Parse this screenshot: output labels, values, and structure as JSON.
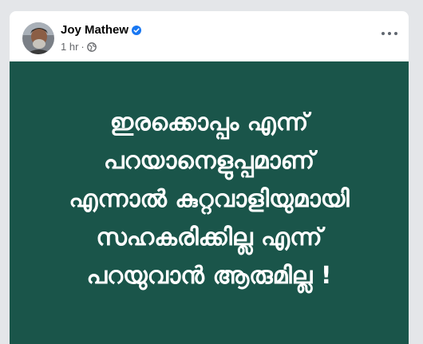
{
  "post": {
    "author": {
      "name": "Joy Mathew",
      "verified_icon": "verified-badge-icon"
    },
    "timestamp": "1 hr",
    "separator": "·",
    "audience_icon": "globe-icon",
    "more_icon": "more-options-icon",
    "image": {
      "background_color": "#1a554a",
      "text_color": "#ffffff",
      "lines": [
        "ഇരക്കൊപ്പം എന്ന്",
        "പറയാനെളുപ്പമാണ്",
        "എന്നാൽ കുറ്റവാളിയുമായി",
        "സഹകരിക്കില്ല എന്ന്",
        "പറയുവാൻ ആരുമില്ല !"
      ]
    }
  },
  "colors": {
    "page_background": "#e4e6e9",
    "card_background": "#ffffff",
    "verified_blue": "#1877f2",
    "secondary_text": "#65676b"
  }
}
